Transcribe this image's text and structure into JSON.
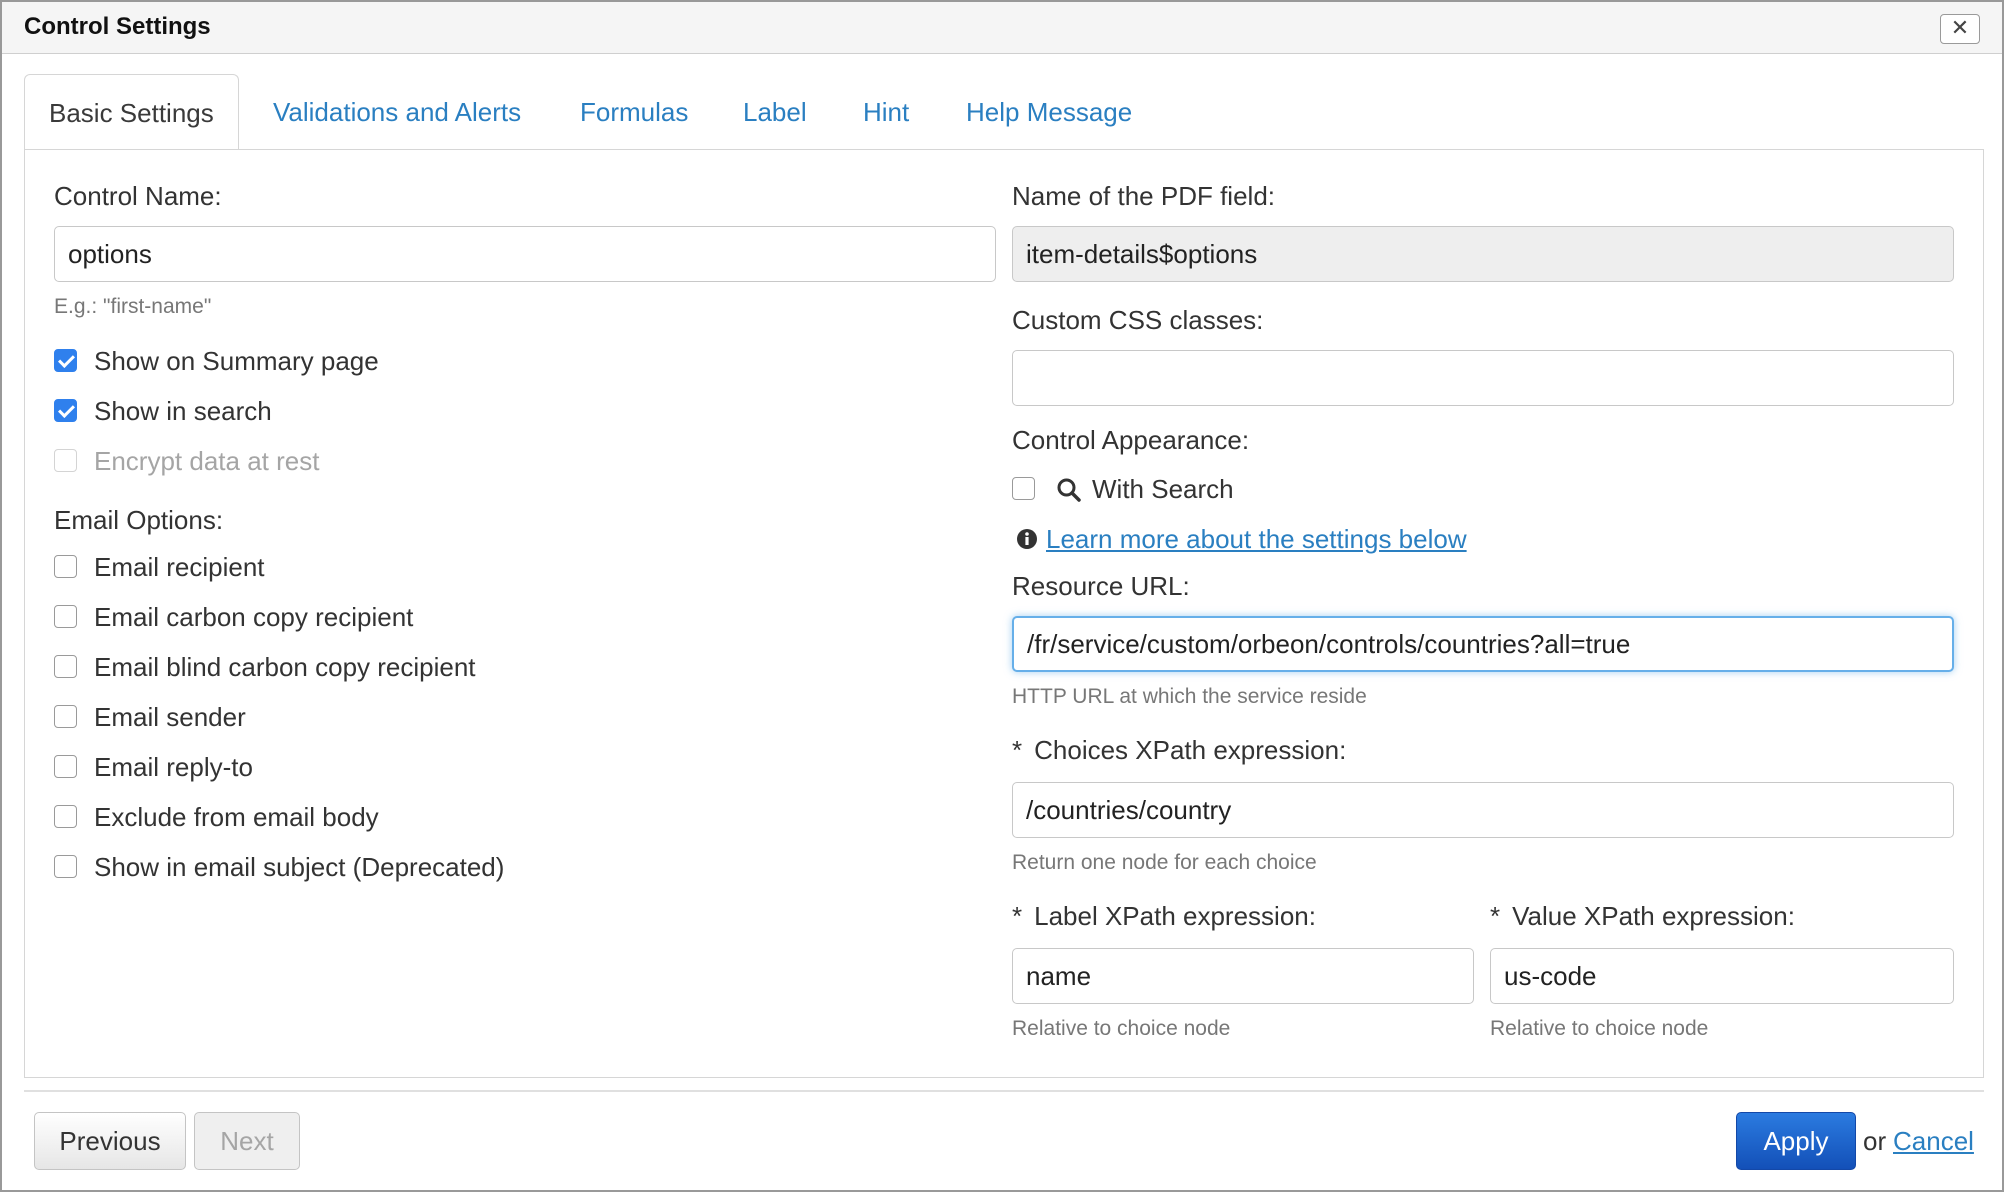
{
  "dialog": {
    "title": "Control Settings",
    "close_label": "✕"
  },
  "tabs": [
    {
      "label": "Basic Settings",
      "active": true
    },
    {
      "label": "Validations and Alerts"
    },
    {
      "label": "Formulas"
    },
    {
      "label": "Label"
    },
    {
      "label": "Hint"
    },
    {
      "label": "Help Message"
    }
  ],
  "left": {
    "control_name": {
      "label": "Control Name:",
      "value": "options",
      "help": "E.g.: \"first-name\""
    },
    "checkboxes": [
      {
        "label": "Show on Summary page",
        "checked": true
      },
      {
        "label": "Show in search",
        "checked": true
      },
      {
        "label": "Encrypt data at rest",
        "checked": false,
        "disabled": true
      }
    ],
    "email_options": {
      "label": "Email Options:",
      "items": [
        {
          "label": "Email recipient",
          "checked": false
        },
        {
          "label": "Email carbon copy recipient",
          "checked": false
        },
        {
          "label": "Email blind carbon copy recipient",
          "checked": false
        },
        {
          "label": "Email sender",
          "checked": false
        },
        {
          "label": "Email reply-to",
          "checked": false
        },
        {
          "label": "Exclude from email body",
          "checked": false
        },
        {
          "label": "Show in email subject (Deprecated)",
          "checked": false
        }
      ]
    }
  },
  "right": {
    "pdf_field": {
      "label": "Name of the PDF field:",
      "value": "item-details$options"
    },
    "css_classes": {
      "label": "Custom CSS classes:",
      "value": ""
    },
    "appearance": {
      "label": "Control Appearance:",
      "with_search_label": "With Search",
      "with_search_checked": false
    },
    "learn_more": "Learn more about the settings below",
    "resource_url": {
      "label": "Resource URL:",
      "value": "/fr/service/custom/orbeon/controls/countries?all=true",
      "help": "HTTP URL at which the service reside"
    },
    "choices_xpath": {
      "required": "*",
      "label": "Choices XPath expression:",
      "value": "/countries/country",
      "help": "Return one node for each choice"
    },
    "label_xpath": {
      "required": "*",
      "label": "Label XPath expression:",
      "value": "name",
      "help": "Relative to choice node"
    },
    "value_xpath": {
      "required": "*",
      "label": "Value XPath expression:",
      "value": "us-code",
      "help": "Relative to choice node"
    }
  },
  "footer": {
    "previous": "Previous",
    "next": "Next",
    "apply": "Apply",
    "or": "or",
    "cancel": "Cancel"
  },
  "colors": {
    "link": "#2a7fc1",
    "primary": "#1a5fc8",
    "checkbox": "#2f80ed",
    "focus": "#66afe9"
  }
}
